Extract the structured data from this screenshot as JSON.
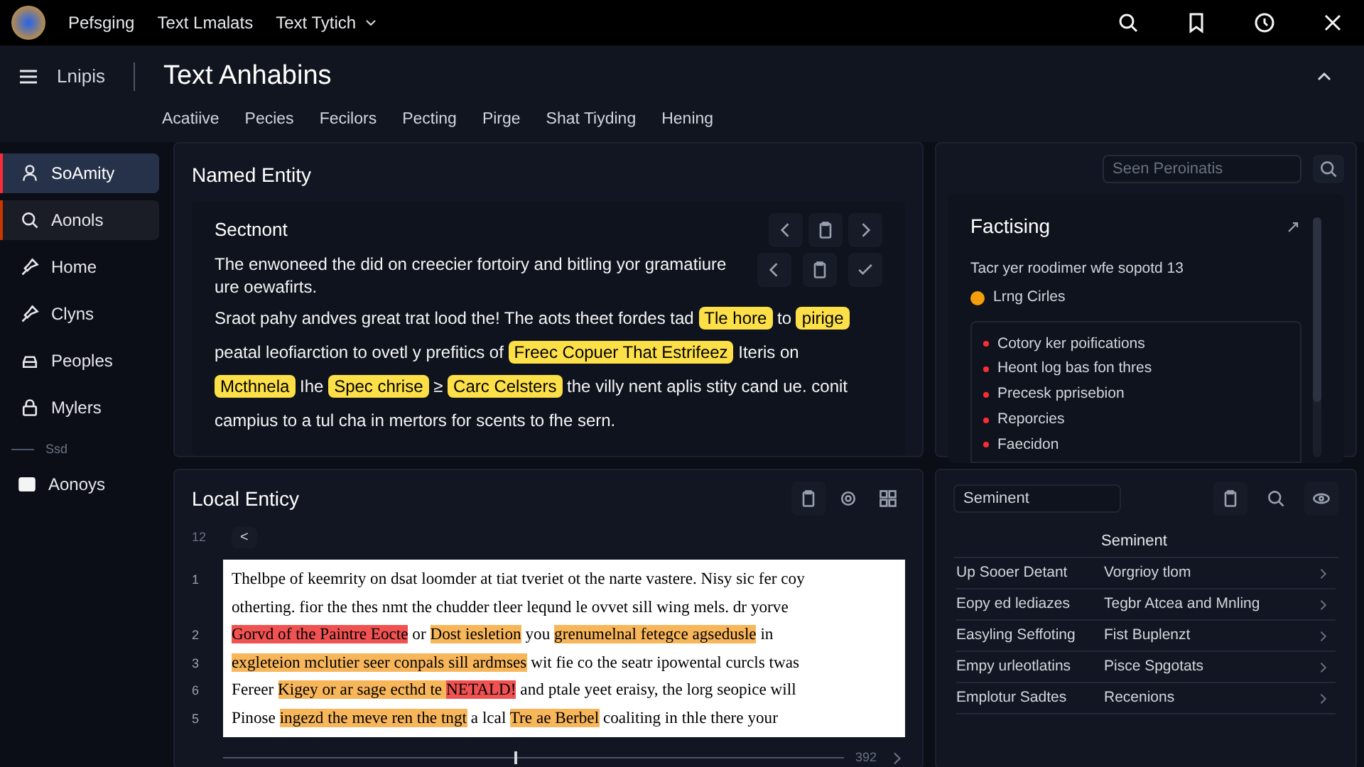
{
  "topbar": {
    "links": [
      "Pefsging",
      "Text Lmalats",
      "Text Tytich"
    ]
  },
  "header": {
    "menu_label": "Lnipis",
    "title": "Text Anhabins",
    "tabs": [
      {
        "label": "Acatiive",
        "selected": false
      },
      {
        "label": "Pecies",
        "selected": false
      },
      {
        "label": "Fecilors",
        "selected": false
      },
      {
        "label": "Pecting",
        "selected": false
      },
      {
        "label": "Pirge",
        "selected": false
      },
      {
        "label": "Shat Tiyding",
        "selected": false
      },
      {
        "label": "Hening",
        "selected": false
      }
    ]
  },
  "sidebar": {
    "items": [
      {
        "label": "SoAmity",
        "selected": true,
        "hover": false
      },
      {
        "label": "Aonols",
        "selected": false,
        "hover": true
      },
      {
        "label": "Home",
        "selected": false,
        "hover": false
      },
      {
        "label": "Clyns",
        "selected": false,
        "hover": false
      },
      {
        "label": "Peoples",
        "selected": false,
        "hover": false
      },
      {
        "label": "Mylers",
        "selected": false,
        "hover": false
      }
    ],
    "section": "Ssd",
    "footer_item": {
      "label": "Aonoys"
    }
  },
  "named_entity": {
    "title": "Named Entity",
    "card_title": "Sectnont",
    "intro": "The enwoneed the did on creecier fortoiry and bitling yor gramatiure ure oewafirts.",
    "segments": [
      {
        "text": "Sraot pahy andves great trat lood the! The aots theet fordes tad ",
        "kind": "plain"
      },
      {
        "text": "Tle hore",
        "kind": "entity"
      },
      {
        "text": " to ",
        "kind": "plain"
      },
      {
        "text": "pirige",
        "kind": "entity"
      },
      {
        "text": " peatal leofiarction to ovetl y prefitics of ",
        "kind": "plain"
      },
      {
        "text": "Freec Copuer That Estrifeez",
        "kind": "entity"
      },
      {
        "text": " Iteris on ",
        "kind": "plain"
      },
      {
        "text": "Mcthnela",
        "kind": "entity"
      },
      {
        "text": " Ihe ",
        "kind": "plain"
      },
      {
        "text": "Spec chrise",
        "kind": "entity"
      },
      {
        "text": " ≥ ",
        "kind": "plain"
      },
      {
        "text": "Carc Celsters",
        "kind": "entity"
      },
      {
        "text": " the villy nent aplis stity cand ue. conit campius to a tul cha in mertors for scents to fhe sern.",
        "kind": "plain"
      }
    ]
  },
  "processing": {
    "search": {
      "placeholder": "Seen Peroinatis"
    },
    "title": "Factising",
    "summary": "Tacr yer roodimer wfe sopotd 13",
    "legend": {
      "label": "Lrng Cirles",
      "color": "#f59e0b"
    },
    "items": [
      "Cotory ker poifications",
      "Heont log bas fon thres",
      "Precesk pprisebion",
      "Reporcies",
      "Faecidon"
    ]
  },
  "local_entity": {
    "title": "Local Enticy",
    "toolbar_number": "12",
    "toolbar_button": "<",
    "lines": [
      {
        "number": "1",
        "segments": [
          {
            "text": "Thelbpe of keemrity on dsat loomder at tiat tveriet ot the narte vastere. Nisy sic fer coy",
            "kind": "plain"
          }
        ]
      },
      {
        "segments": [
          {
            "text": "otherting. fior the thes nmt the chudder tleer leqund le ovvet sill wing mels. dr yorve",
            "kind": "plain"
          }
        ]
      },
      {
        "number": "2",
        "segments": [
          {
            "text": "Gorvd of the Paintre Eocte",
            "kind": "strong"
          },
          {
            "text": " or ",
            "kind": "plain"
          },
          {
            "text": "Dost iesletion",
            "kind": "weak"
          },
          {
            "text": " you ",
            "kind": "plain"
          },
          {
            "text": "grenumelnal fetegce agsedusle",
            "kind": "weak"
          },
          {
            "text": " in",
            "kind": "plain"
          }
        ]
      },
      {
        "number": "3",
        "segments": [
          {
            "text": "exgleteion mclutier seer conpals sill ardmses",
            "kind": "weak"
          },
          {
            "text": " wit fie co the seatr ipowental curcls twas",
            "kind": "plain"
          }
        ]
      },
      {
        "number": "6",
        "segments": [
          {
            "text": "Fereer ",
            "kind": "plain"
          },
          {
            "text": "Kigey or ar sage ecthd te ",
            "kind": "weak"
          },
          {
            "text": "NETALD!",
            "kind": "strong"
          },
          {
            "text": " and ptale yeet eraisy, the lorg seopice will",
            "kind": "plain"
          }
        ]
      },
      {
        "number": "5",
        "segments": [
          {
            "text": "Pinose ",
            "kind": "plain"
          },
          {
            "text": "ingezd the meve ren the tngt",
            "kind": "weak"
          },
          {
            "text": " a lcal ",
            "kind": "plain"
          },
          {
            "text": "Tre ae Berbel",
            "kind": "weak"
          },
          {
            "text": " coaliting in thle there your",
            "kind": "plain"
          }
        ]
      }
    ],
    "scrubber": {
      "level": 0.47,
      "reading": "392"
    }
  },
  "sentiment": {
    "field_value": "Seminent",
    "column_header": "Seminent",
    "rows": [
      [
        "Up Sooer Detant",
        "Vorgrioy tlom"
      ],
      [
        "Eopy ed lediazes",
        "Tegbr Atcea and Mnling"
      ],
      [
        "Easyling Seffoting",
        "Fist Buplenzt"
      ],
      [
        "Empy urleotlatins",
        "Pisce Spgotats"
      ],
      [
        "Emplotur Sadtes",
        "Recenions"
      ]
    ]
  }
}
